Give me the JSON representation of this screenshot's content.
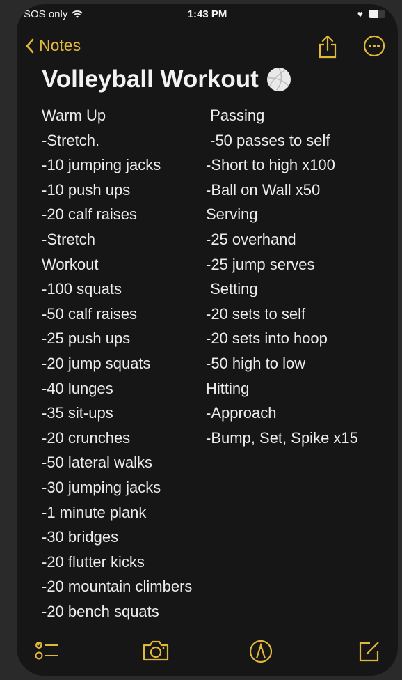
{
  "status_bar": {
    "carrier": "SOS only",
    "time": "1:43 PM",
    "battery_level_percent": 55
  },
  "nav": {
    "back_label": "Notes",
    "share_icon": "share-icon",
    "more_icon": "ellipsis-circle-icon"
  },
  "note": {
    "title": "Volleyball Workout",
    "title_emoji": "volleyball-icon",
    "left_column": [
      "Warm Up",
      "-Stretch.",
      "-10 jumping jacks",
      "-10 push ups",
      "-20 calf raises",
      "-Stretch",
      "Workout",
      "-100 squats",
      "-50 calf raises",
      "-25 push ups",
      "-20 jump squats",
      "-40 lunges",
      "-35 sit-ups",
      "-20 crunches",
      "-50 lateral walks",
      "-30 jumping jacks",
      "-1 minute plank",
      "-30 bridges",
      "-20 flutter kicks",
      "-20 mountain climbers",
      "-20 bench squats"
    ],
    "right_column": [
      " Passing",
      " -50 passes to self",
      "-Short to high x100",
      "-Ball on Wall x50",
      "Serving",
      "-25 overhand",
      "-25 jump serves",
      " Setting",
      "-20 sets to self",
      "-20 sets into hoop",
      "-50 high to low",
      "Hitting",
      "-Approach",
      "-Bump, Set, Spike x15"
    ]
  },
  "toolbar": {
    "items": [
      "checklist-icon",
      "camera-icon",
      "markup-icon",
      "compose-icon"
    ]
  },
  "colors": {
    "accent": "#e2b83a",
    "background": "#161616",
    "text": "#ececec"
  }
}
